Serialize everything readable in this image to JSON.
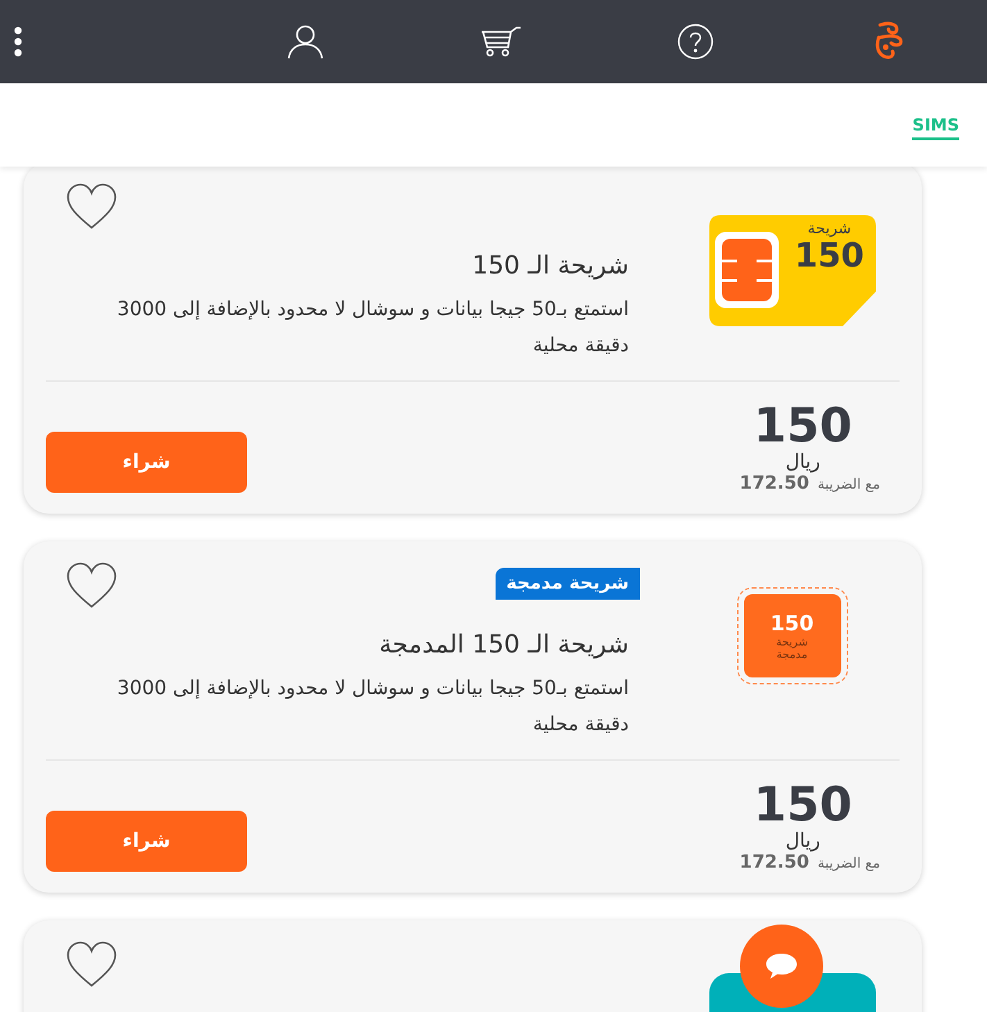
{
  "tabs": [
    {
      "label": "SIMS",
      "selected": true
    }
  ],
  "products": [
    {
      "favorite": false,
      "image": {
        "kind": "sim-card",
        "label": "شريحة",
        "number": "150"
      },
      "title": "شريحة الـ 150",
      "description": "استمتع بـ50 جيجا بيانات و سوشال لا محدود بالإضافة إلى 3000 دقيقة محلية",
      "price": "150",
      "currency": "ريال",
      "tax_label": "مع الضريبة",
      "tax_price": "172.50",
      "buy_label": "شراء"
    },
    {
      "favorite": false,
      "badge": "شريحة مدمجة",
      "image": {
        "kind": "esim",
        "label": "شريحة مدمجة",
        "number": "150"
      },
      "title": "شريحة الـ 150 المدمجة",
      "description": "استمتع بـ50 جيجا بيانات و سوشال لا محدود بالإضافة إلى 3000 دقيقة محلية",
      "price": "150",
      "currency": "ريال",
      "tax_label": "مع الضريبة",
      "tax_price": "172.50",
      "buy_label": "شراء"
    },
    {
      "favorite": false,
      "image": {
        "kind": "plain"
      }
    }
  ]
}
